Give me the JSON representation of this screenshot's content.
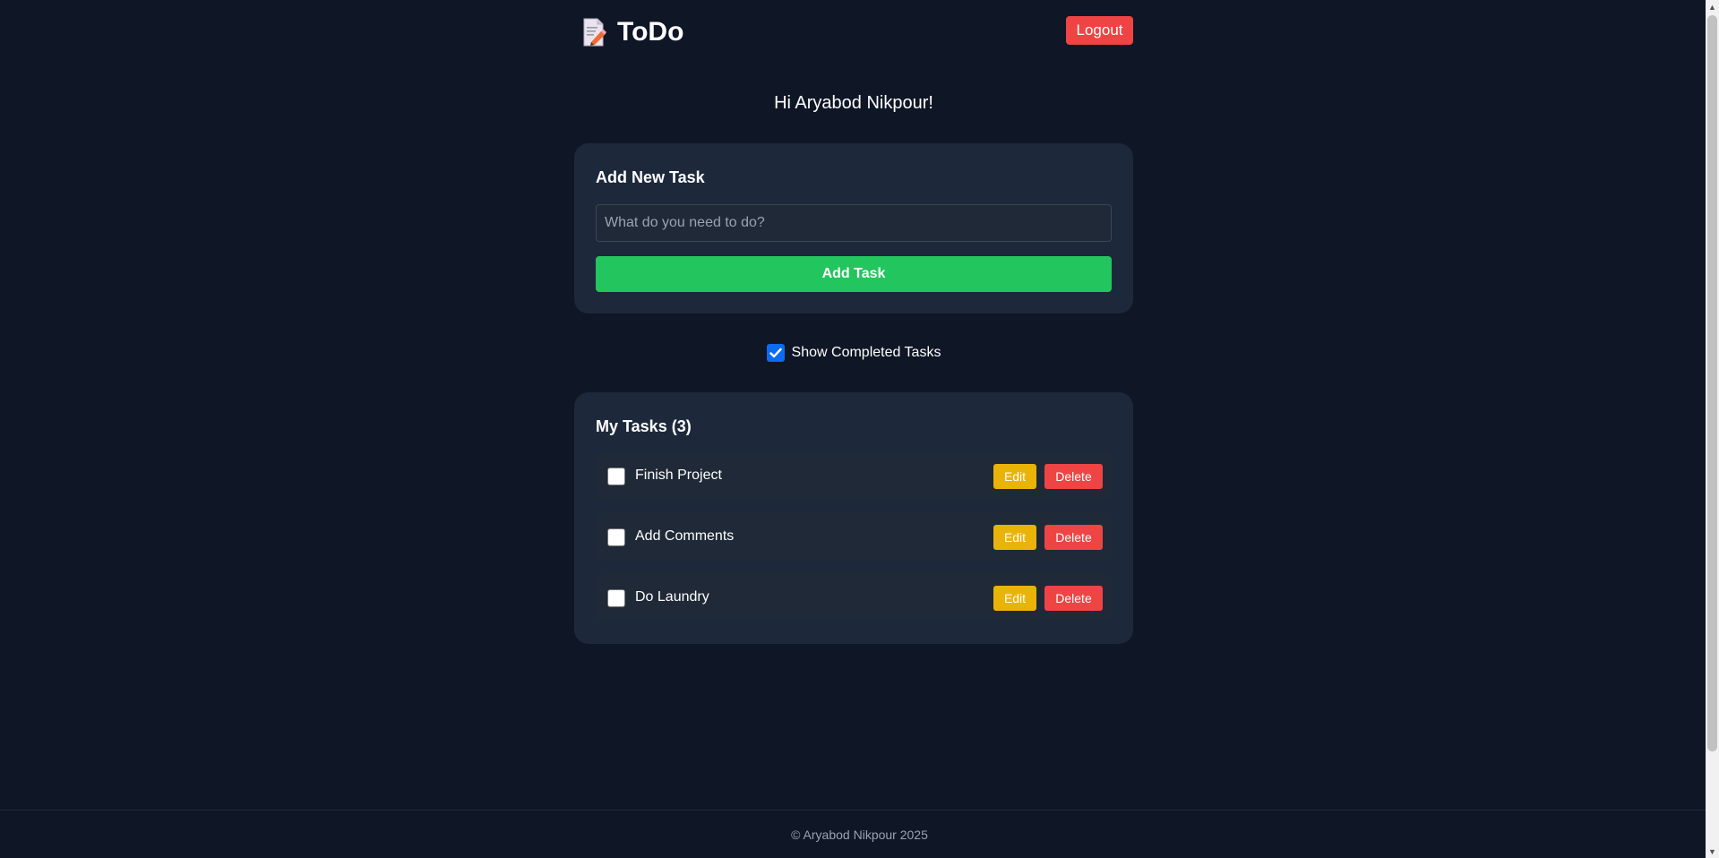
{
  "header": {
    "title": "ToDo",
    "logo_icon": "memo-icon",
    "logout_label": "Logout"
  },
  "greeting": "Hi Aryabod Nikpour!",
  "add_task": {
    "heading": "Add New Task",
    "input_placeholder": "What do you need to do?",
    "input_value": "",
    "button_label": "Add Task"
  },
  "filter": {
    "show_completed_label": "Show Completed Tasks",
    "show_completed_checked": true
  },
  "tasks": {
    "heading": "My Tasks (3)",
    "items": [
      {
        "label": "Finish Project",
        "done": false,
        "edit_label": "Edit",
        "delete_label": "Delete"
      },
      {
        "label": "Add Comments",
        "done": false,
        "edit_label": "Edit",
        "delete_label": "Delete"
      },
      {
        "label": "Do Laundry",
        "done": false,
        "edit_label": "Edit",
        "delete_label": "Delete"
      }
    ]
  },
  "footer": {
    "copyright": "© Aryabod Nikpour 2025"
  },
  "colors": {
    "background": "#0f1626",
    "card": "#1d283b",
    "primary_green": "#22c55e",
    "danger_red": "#ef4444",
    "edit_yellow": "#eab308",
    "checkbox_blue": "#0b6bf2"
  }
}
